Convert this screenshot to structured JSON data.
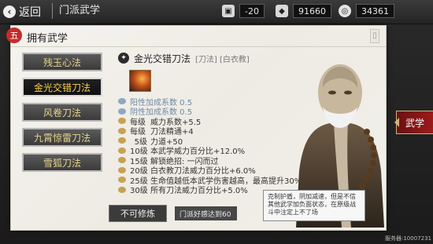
{
  "topbar": {
    "back_label": "返回",
    "title": "门派武学",
    "resources": [
      {
        "icon": "stamina-icon",
        "value": "-20"
      },
      {
        "icon": "silver-icon",
        "value": "91660"
      },
      {
        "icon": "coin-icon",
        "value": "34361"
      }
    ]
  },
  "panel": {
    "title": "拥有武学",
    "skills": [
      {
        "label": "残玉心法",
        "active": false
      },
      {
        "label": "金光交错刀法",
        "active": true
      },
      {
        "label": "风卷刀法",
        "active": false
      },
      {
        "label": "九霄惊雷刀法",
        "active": false
      },
      {
        "label": "雪狐刀法",
        "active": false
      }
    ],
    "selected": {
      "name": "金光交错刀法",
      "tags": "[刀法] [白衣教]",
      "rows": [
        {
          "level": "",
          "text": "阳性加成系数 0.5",
          "style": "blue"
        },
        {
          "level": "",
          "text": "阴性加成系数 0.5",
          "style": "blue"
        },
        {
          "level": "每级",
          "text": "威力系数+5.5"
        },
        {
          "level": "每级",
          "text": "刀法精通+4"
        },
        {
          "level": "5级",
          "text": "力道+50"
        },
        {
          "level": "10级",
          "text": "本武学威力百分比+12.0%"
        },
        {
          "level": "15级",
          "text": "解锁绝招: 一闪而过"
        },
        {
          "level": "20级",
          "text": "白衣教刀法威力百分比+6.0%"
        },
        {
          "level": "25级",
          "text": "生命值越低本武学伤害越高，最高提升30%"
        },
        {
          "level": "30级",
          "text": "所有刀法威力百分比+5.0%"
        }
      ]
    },
    "bottom": {
      "cannot_train": "不可修炼",
      "note": "门派好感达到60"
    }
  },
  "bubble_text": "克制护盾，阴加减速，但是不信其他武学加负面状态，在原级战斗中注定上不了场",
  "right_tab": "武学",
  "build_id": "服务器:10007231"
}
